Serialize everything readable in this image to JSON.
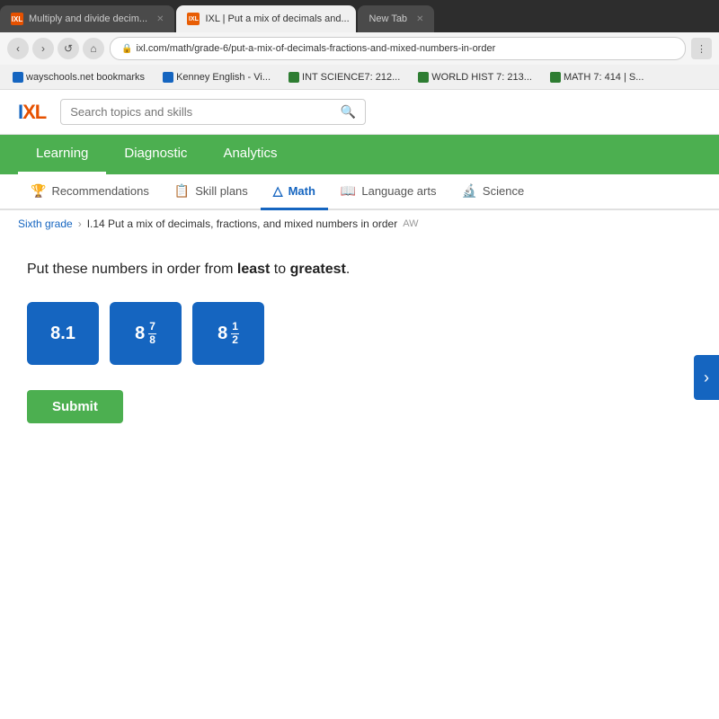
{
  "browser": {
    "tabs": [
      {
        "id": "tab1",
        "label": "Multiply and divide decim...",
        "favicon_type": "orange",
        "active": false
      },
      {
        "id": "tab2",
        "label": "IXL | Put a mix of decimals and...",
        "favicon_type": "ixl",
        "active": true
      },
      {
        "id": "tab3",
        "label": "New Tab",
        "favicon_type": "none",
        "active": false
      }
    ],
    "address": "ixl.com/math/grade-6/put-a-mix-of-decimals-fractions-and-mixed-numbers-in-order",
    "bookmarks": [
      {
        "label": "wayschools.net bookmarks",
        "favicon": "blue"
      },
      {
        "label": "Kenney English - Vi...",
        "favicon": "blue"
      },
      {
        "label": "INT SCIENCE7: 212...",
        "favicon": "green"
      },
      {
        "label": "WORLD HIST 7: 213...",
        "favicon": "green"
      },
      {
        "label": "MATH 7: 414 | S...",
        "favicon": "green"
      }
    ]
  },
  "ixl": {
    "logo_i": "I",
    "logo_xl": "XL",
    "search_placeholder": "Search topics and skills",
    "nav_items": [
      {
        "label": "Learning",
        "active": true
      },
      {
        "label": "Diagnostic",
        "active": false
      },
      {
        "label": "Analytics",
        "active": false
      }
    ],
    "subnav_items": [
      {
        "label": "Recommendations",
        "icon": "🏆",
        "active": false
      },
      {
        "label": "Skill plans",
        "icon": "📋",
        "active": false
      },
      {
        "label": "Math",
        "icon": "△",
        "active": true
      },
      {
        "label": "Language arts",
        "icon": "📖",
        "active": false
      },
      {
        "label": "Science",
        "icon": "🔬",
        "active": false
      }
    ],
    "breadcrumb": {
      "grade": "Sixth grade",
      "topic": "I.14 Put a mix of decimals, fractions, and mixed numbers in order",
      "code": "AW"
    },
    "question": {
      "text_prefix": "Put these numbers in order from ",
      "text_least": "least",
      "text_middle": " to ",
      "text_greatest": "greatest",
      "text_suffix": ".",
      "tiles": [
        {
          "id": "tile1",
          "display_type": "decimal",
          "value": "8.1"
        },
        {
          "id": "tile2",
          "display_type": "mixed_fraction",
          "whole": "8",
          "numerator": "7",
          "denominator": "8"
        },
        {
          "id": "tile3",
          "display_type": "mixed_fraction",
          "whole": "8",
          "numerator": "1",
          "denominator": "2"
        }
      ]
    },
    "submit_label": "Submit"
  }
}
